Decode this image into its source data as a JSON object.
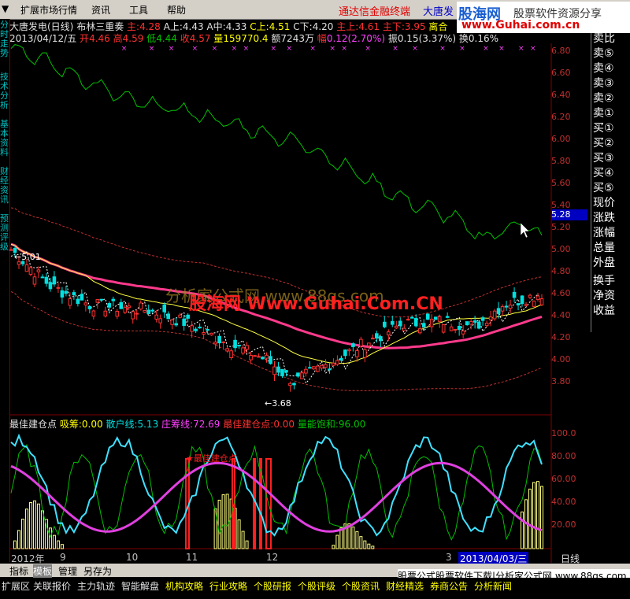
{
  "menu": {
    "items": [
      "扩展市场行情",
      "资讯",
      "工具",
      "帮助"
    ],
    "promo": "通达信金融终端",
    "stock_name": "大唐发"
  },
  "logo": {
    "brand": "股海网",
    "tagline": "股票软件资源分享",
    "url": "www.Guhai.com.cn"
  },
  "left_tabs": [
    "分时走势",
    "技术分析",
    "基本资料",
    "财经资讯",
    "预测评级"
  ],
  "header": {
    "title": "大唐发电(日线)",
    "indicator": "布林三重奏",
    "main_label": "主:",
    "main_val": "4.28",
    "a_label": "A上:",
    "a_val": "4.43",
    "b_label": "A中:",
    "b_val": "4.33",
    "c_label": "C上:",
    "c_val": "4.51",
    "d_label": "C下:",
    "d_val": "4.20",
    "e_label": "主上:",
    "e_val": "4.61",
    "f_label": "主下:",
    "f_val": "3.95",
    "g_label": "离合"
  },
  "quote": {
    "date": "2013/04/12/五",
    "open_label": "开",
    "open": "4.46",
    "high_label": "高",
    "high": "4.59",
    "low_label": "低",
    "low": "4.44",
    "close_label": "收",
    "close": "4.57",
    "vol_label": "量",
    "vol": "159770.4",
    "amt_label": "额",
    "amt": "7243万",
    "chg_label": "幅",
    "chg": "0.12(2.70%)",
    "amp_label": "振",
    "amp": "0.15(3.37%)",
    "turn_label": "换",
    "turn": "0.16%"
  },
  "right_panel": [
    "卖比",
    "卖⑤",
    "卖④",
    "卖③",
    "卖②",
    "卖①",
    "买①",
    "买②",
    "买③",
    "买④",
    "买⑤",
    "现价",
    "涨跌",
    "涨幅",
    "总量",
    "外盘",
    "换手",
    "净资",
    "收益"
  ],
  "current_price": "5.28",
  "price_axis": [
    "6.80",
    "6.60",
    "6.40",
    "6.20",
    "6.00",
    "5.80",
    "5.60",
    "5.40",
    "5.20",
    "5.00",
    "4.80",
    "4.60",
    "4.40",
    "4.20",
    "4.00",
    "3.80"
  ],
  "price_labels": {
    "high": "5.01",
    "low": "3.68"
  },
  "watermarks": {
    "w1": "分析家公式网 www.88gs.com",
    "w2": "股海网 Www.Guhai.Com.CN"
  },
  "indicator": {
    "name": "最佳建仓点",
    "buy_label": "吸筹:",
    "buy_val": "0.00",
    "retail_label": "散户线:",
    "retail_val": "5.13",
    "dealer_label": "庄筹线:",
    "dealer_val": "72.69",
    "best_label": "最佳建仓点:",
    "best_val": "0.00",
    "sat_label": "量能饱和:",
    "sat_val": "96.00",
    "axis": [
      "100.0",
      "80.00",
      "60.00",
      "40.00",
      "20.00"
    ],
    "marker": "★最佳建仓点"
  },
  "date_axis": [
    "2012年",
    "9",
    "10",
    "11",
    "12",
    "3"
  ],
  "date_cursor": "2013/04/03/三",
  "period": "日线",
  "bottom_tabs": [
    "指标",
    "模板",
    "管理",
    "另存为"
  ],
  "bottom_bar": [
    "扩展区",
    "关联报价",
    "主力轨迹",
    "智能解盘",
    "机构攻略",
    "行业攻略",
    "个股研报",
    "个股评级",
    "个股资讯",
    "财经精选",
    "券商公告",
    "分析新闻"
  ],
  "download_banner": "股票公式股票软件下载|分析家公式网 www.88gs.com",
  "colors": {
    "up": "#ff3030",
    "down": "#00e0e0",
    "boll_mid": "#ff3a8c",
    "boll_band": "#c03030",
    "yellow": "#ffff00",
    "green": "#00c000"
  }
}
